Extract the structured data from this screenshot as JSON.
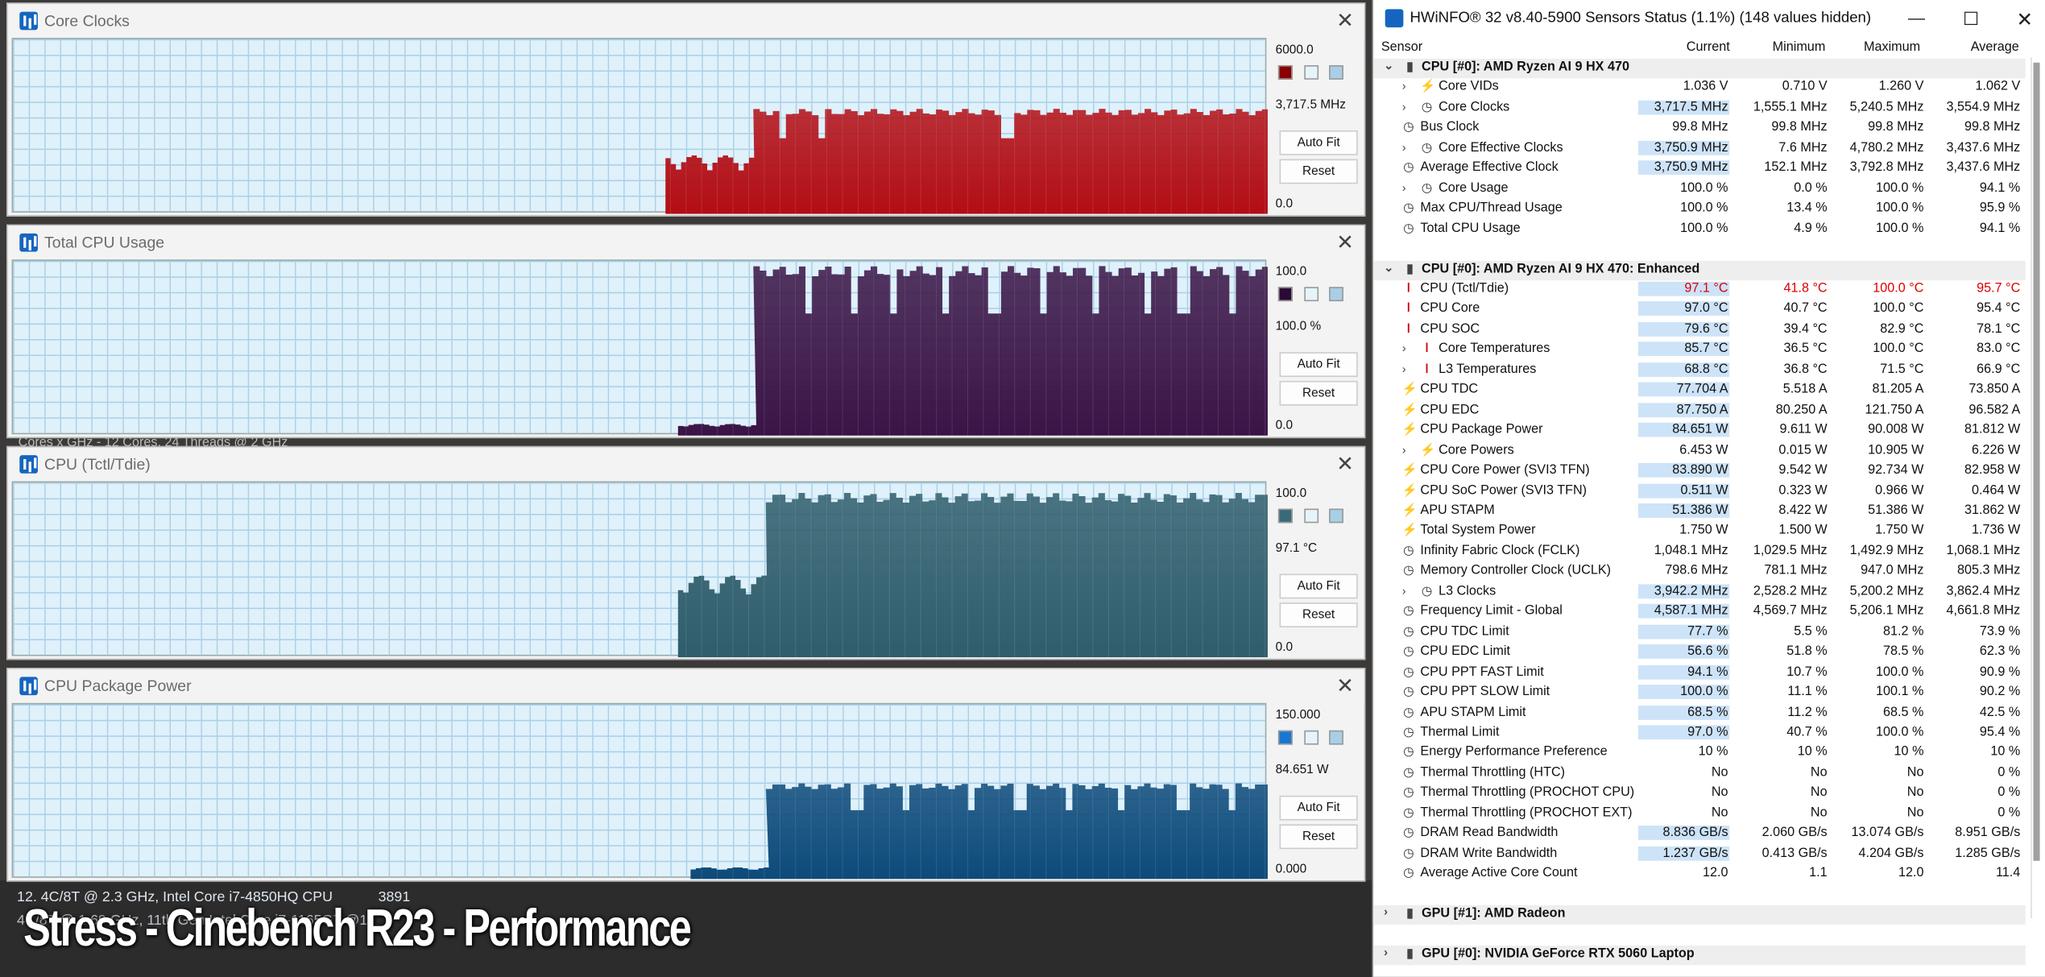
{
  "graph_windows": [
    {
      "title": "Core Clocks",
      "max": "6000.0",
      "current": "3,717.5 MHz",
      "min": "0.0",
      "color": "#b30d14",
      "swatch": "#8a0000",
      "buttons": [
        "Auto Fit",
        "Reset"
      ],
      "chart_data": {
        "type": "area",
        "ylim": [
          0,
          6000
        ],
        "unit": "MHz",
        "start": 0.52,
        "step": 0.59,
        "initial": 1800,
        "level": 3717,
        "dips": [
          0.61,
          0.64,
          0.79
        ]
      }
    },
    {
      "title": "Total CPU Usage",
      "max": "100.0",
      "current": "100.0 %",
      "min": "0.0",
      "color": "#3a1446",
      "swatch": "#2a0a33",
      "buttons": [
        "Auto Fit",
        "Reset"
      ],
      "chart_data": {
        "type": "area",
        "ylim": [
          0,
          100
        ],
        "unit": "%",
        "start": 0.53,
        "step": 0.59,
        "initial": 6,
        "level": 100,
        "dips": [
          0.63,
          0.67,
          0.7,
          0.74,
          0.78,
          0.82,
          0.86,
          0.9,
          0.93,
          0.97
        ]
      }
    },
    {
      "title": "CPU (Tctl/Tdie)",
      "max": "100.0",
      "current": "97.1 °C",
      "min": "0.0",
      "color": "#2f5d6b",
      "swatch": "#3a6a7a",
      "buttons": [
        "Auto Fit",
        "Reset"
      ],
      "chart_data": {
        "type": "area",
        "ylim": [
          0,
          100
        ],
        "unit": "°C",
        "start": 0.53,
        "step": 0.6,
        "initial": 42,
        "level": 97,
        "dips": []
      }
    },
    {
      "title": "CPU Package Power",
      "max": "150.000",
      "current": "84.651 W",
      "min": "0.000",
      "color": "#0d4a7a",
      "swatch": "#1976d2",
      "buttons": [
        "Auto Fit",
        "Reset"
      ],
      "chart_data": {
        "type": "area",
        "ylim": [
          0,
          150
        ],
        "unit": "W",
        "start": 0.54,
        "step": 0.6,
        "initial": 9,
        "level": 84.6,
        "dips": [
          0.67,
          0.71,
          0.76,
          0.8,
          0.84,
          0.88,
          0.93,
          0.97
        ]
      }
    }
  ],
  "background": {
    "lines": [
      "Cores x GHz - 12 Cores, 24 Threads @ 2 GHz",
      "12. 4C/8T @ 2.3 GHz, Intel Core i7-4850HQ CPU",
      "4C/8T @ 1.69 GHz, 11th Gen Intel Core i7-1165G7 @1"
    ],
    "score": "3891",
    "overlay": "Stress - Cinebench R23 - Performance"
  },
  "hwinfo": {
    "title": "HWiNFO® 32 v8.40-5900 Sensors Status (1.1%) (148 values hidden)",
    "columns": {
      "sensor": "Sensor",
      "current": "Current",
      "minimum": "Minimum",
      "maximum": "Maximum",
      "average": "Average"
    },
    "rows": [
      {
        "g": 1,
        "name": "CPU [#0]: AMD Ryzen AI 9 HX 470"
      },
      {
        "i": 1,
        "ex": 1,
        "sym": "bolt",
        "name": "Core VIDs",
        "cur": "1.036 V",
        "min": "0.710 V",
        "max": "1.260 V",
        "avg": "1.062 V"
      },
      {
        "i": 1,
        "ex": 1,
        "sym": "clk",
        "name": "Core Clocks",
        "cur": "3,717.5 MHz",
        "min": "1,555.1 MHz",
        "max": "5,240.5 MHz",
        "avg": "3,554.9 MHz",
        "hl": 1
      },
      {
        "i": 0,
        "sym": "clk",
        "name": "Bus Clock",
        "cur": "99.8 MHz",
        "min": "99.8 MHz",
        "max": "99.8 MHz",
        "avg": "99.8 MHz"
      },
      {
        "i": 1,
        "ex": 1,
        "sym": "clk",
        "name": "Core Effective Clocks",
        "cur": "3,750.9 MHz",
        "min": "7.6 MHz",
        "max": "4,780.2 MHz",
        "avg": "3,437.6 MHz",
        "hl": 1
      },
      {
        "i": 0,
        "sym": "clk",
        "name": "Average Effective Clock",
        "cur": "3,750.9 MHz",
        "min": "152.1 MHz",
        "max": "3,792.8 MHz",
        "avg": "3,437.6 MHz",
        "hl": 1
      },
      {
        "i": 1,
        "ex": 1,
        "sym": "clk",
        "name": "Core Usage",
        "cur": "100.0 %",
        "min": "0.0 %",
        "max": "100.0 %",
        "avg": "94.1 %"
      },
      {
        "i": 0,
        "sym": "clk",
        "name": "Max CPU/Thread Usage",
        "cur": "100.0 %",
        "min": "13.4 %",
        "max": "100.0 %",
        "avg": "95.9 %"
      },
      {
        "i": 0,
        "sym": "clk",
        "name": "Total CPU Usage",
        "cur": "100.0 %",
        "min": "4.9 %",
        "max": "100.0 %",
        "avg": "94.1 %"
      },
      {
        "blank": 1
      },
      {
        "g": 1,
        "name": "CPU [#0]: AMD Ryzen AI 9 HX 470: Enhanced"
      },
      {
        "i": 0,
        "sym": "therm",
        "name": "CPU (Tctl/Tdie)",
        "cur": "97.1 °C",
        "min": "41.8 °C",
        "max": "100.0 °C",
        "avg": "95.7 °C",
        "hl": 1,
        "red": 1
      },
      {
        "i": 0,
        "sym": "therm",
        "name": "CPU Core",
        "cur": "97.0 °C",
        "min": "40.7 °C",
        "max": "100.0 °C",
        "avg": "95.4 °C",
        "hl": 1
      },
      {
        "i": 0,
        "sym": "therm",
        "name": "CPU SOC",
        "cur": "79.6 °C",
        "min": "39.4 °C",
        "max": "82.9 °C",
        "avg": "78.1 °C",
        "hl": 1
      },
      {
        "i": 1,
        "ex": 1,
        "sym": "therm",
        "name": "Core Temperatures",
        "cur": "85.7 °C",
        "min": "36.5 °C",
        "max": "100.0 °C",
        "avg": "83.0 °C",
        "hl": 1
      },
      {
        "i": 1,
        "ex": 1,
        "sym": "therm",
        "name": "L3 Temperatures",
        "cur": "68.8 °C",
        "min": "36.8 °C",
        "max": "71.5 °C",
        "avg": "66.9 °C",
        "hl": 1
      },
      {
        "i": 0,
        "sym": "bolt",
        "name": "CPU TDC",
        "cur": "77.704 A",
        "min": "5.518 A",
        "max": "81.205 A",
        "avg": "73.850 A",
        "hl": 1
      },
      {
        "i": 0,
        "sym": "bolt",
        "name": "CPU EDC",
        "cur": "87.750 A",
        "min": "80.250 A",
        "max": "121.750 A",
        "avg": "96.582 A",
        "hl": 1
      },
      {
        "i": 0,
        "sym": "bolt",
        "name": "CPU Package Power",
        "cur": "84.651 W",
        "min": "9.611 W",
        "max": "90.008 W",
        "avg": "81.812 W",
        "hl": 1
      },
      {
        "i": 1,
        "ex": 1,
        "sym": "bolt",
        "name": "Core Powers",
        "cur": "6.453 W",
        "min": "0.015 W",
        "max": "10.905 W",
        "avg": "6.226 W"
      },
      {
        "i": 0,
        "sym": "bolt",
        "name": "CPU Core Power (SVI3 TFN)",
        "cur": "83.890 W",
        "min": "9.542 W",
        "max": "92.734 W",
        "avg": "82.958 W",
        "hl": 1
      },
      {
        "i": 0,
        "sym": "bolt",
        "name": "CPU SoC Power (SVI3 TFN)",
        "cur": "0.511 W",
        "min": "0.323 W",
        "max": "0.966 W",
        "avg": "0.464 W",
        "hl": 1
      },
      {
        "i": 0,
        "sym": "bolt",
        "name": "APU STAPM",
        "cur": "51.386 W",
        "min": "8.422 W",
        "max": "51.386 W",
        "avg": "31.862 W",
        "hl": 1
      },
      {
        "i": 0,
        "sym": "bolt",
        "name": "Total System Power",
        "cur": "1.750 W",
        "min": "1.500 W",
        "max": "1.750 W",
        "avg": "1.736 W"
      },
      {
        "i": 0,
        "sym": "clk",
        "name": "Infinity Fabric Clock (FCLK)",
        "cur": "1,048.1 MHz",
        "min": "1,029.5 MHz",
        "max": "1,492.9 MHz",
        "avg": "1,068.1 MHz"
      },
      {
        "i": 0,
        "sym": "clk",
        "name": "Memory Controller Clock (UCLK)",
        "cur": "798.6 MHz",
        "min": "781.1 MHz",
        "max": "947.0 MHz",
        "avg": "805.3 MHz"
      },
      {
        "i": 1,
        "ex": 1,
        "sym": "clk",
        "name": "L3 Clocks",
        "cur": "3,942.2 MHz",
        "min": "2,528.2 MHz",
        "max": "5,200.2 MHz",
        "avg": "3,862.4 MHz",
        "hl": 1
      },
      {
        "i": 0,
        "sym": "clk",
        "name": "Frequency Limit - Global",
        "cur": "4,587.1 MHz",
        "min": "4,569.7 MHz",
        "max": "5,206.1 MHz",
        "avg": "4,661.8 MHz",
        "hl": 1
      },
      {
        "i": 0,
        "sym": "clk",
        "name": "CPU TDC Limit",
        "cur": "77.7 %",
        "min": "5.5 %",
        "max": "81.2 %",
        "avg": "73.9 %",
        "hl": 1
      },
      {
        "i": 0,
        "sym": "clk",
        "name": "CPU EDC Limit",
        "cur": "56.6 %",
        "min": "51.8 %",
        "max": "78.5 %",
        "avg": "62.3 %",
        "hl": 1
      },
      {
        "i": 0,
        "sym": "clk",
        "name": "CPU PPT FAST Limit",
        "cur": "94.1 %",
        "min": "10.7 %",
        "max": "100.0 %",
        "avg": "90.9 %",
        "hl": 1
      },
      {
        "i": 0,
        "sym": "clk",
        "name": "CPU PPT SLOW Limit",
        "cur": "100.0 %",
        "min": "11.1 %",
        "max": "100.1 %",
        "avg": "90.2 %",
        "hl": 1
      },
      {
        "i": 0,
        "sym": "clk",
        "name": "APU STAPM Limit",
        "cur": "68.5 %",
        "min": "11.2 %",
        "max": "68.5 %",
        "avg": "42.5 %",
        "hl": 1
      },
      {
        "i": 0,
        "sym": "clk",
        "name": "Thermal Limit",
        "cur": "97.0 %",
        "min": "40.7 %",
        "max": "100.0 %",
        "avg": "95.4 %",
        "hl": 1
      },
      {
        "i": 0,
        "sym": "clk",
        "name": "Energy Performance Preference",
        "cur": "10 %",
        "min": "10 %",
        "max": "10 %",
        "avg": "10 %"
      },
      {
        "i": 0,
        "sym": "clk",
        "name": "Thermal Throttling (HTC)",
        "cur": "No",
        "min": "No",
        "max": "No",
        "avg": "0 %"
      },
      {
        "i": 0,
        "sym": "clk",
        "name": "Thermal Throttling (PROCHOT CPU)",
        "cur": "No",
        "min": "No",
        "max": "No",
        "avg": "0 %"
      },
      {
        "i": 0,
        "sym": "clk",
        "name": "Thermal Throttling (PROCHOT EXT)",
        "cur": "No",
        "min": "No",
        "max": "No",
        "avg": "0 %"
      },
      {
        "i": 0,
        "sym": "clk",
        "name": "DRAM Read Bandwidth",
        "cur": "8.836 GB/s",
        "min": "2.060 GB/s",
        "max": "13.074 GB/s",
        "avg": "8.951 GB/s",
        "hl": 1
      },
      {
        "i": 0,
        "sym": "clk",
        "name": "DRAM Write Bandwidth",
        "cur": "1.237 GB/s",
        "min": "0.413 GB/s",
        "max": "4.204 GB/s",
        "avg": "1.285 GB/s",
        "hl": 1
      },
      {
        "i": 0,
        "sym": "clk",
        "name": "Average Active Core Count",
        "cur": "12.0",
        "min": "1.1",
        "max": "12.0",
        "avg": "11.4"
      },
      {
        "blank": 1
      },
      {
        "g": 1,
        "col": 1,
        "name": "GPU [#1]: AMD Radeon"
      },
      {
        "blank": 1
      },
      {
        "g": 1,
        "col": 1,
        "name": "GPU [#0]: NVIDIA GeForce RTX 5060 Laptop"
      }
    ]
  }
}
